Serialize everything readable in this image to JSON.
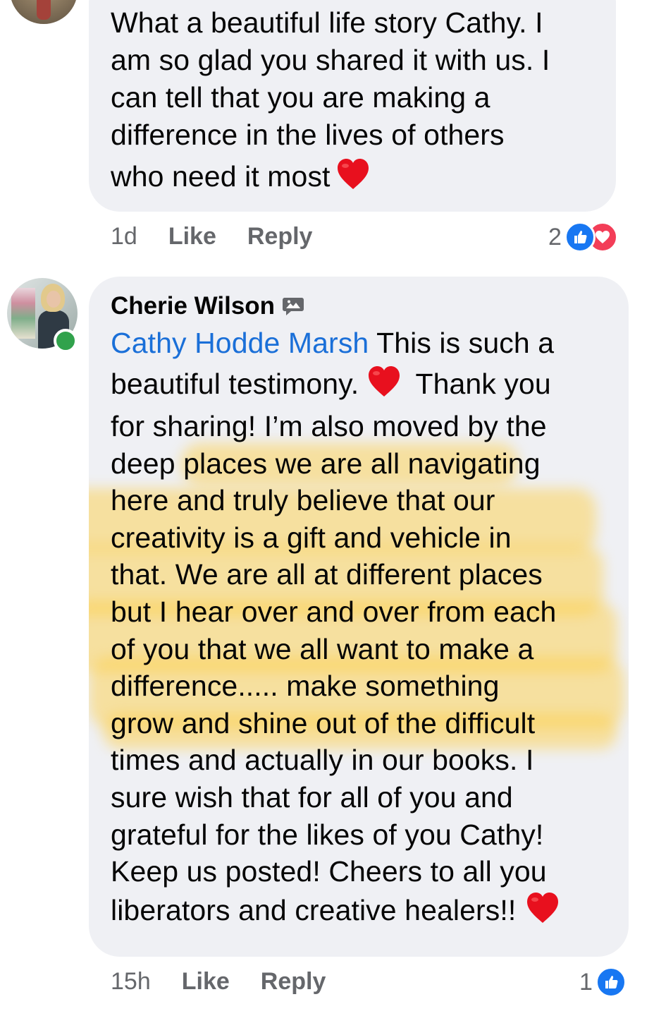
{
  "comment_1": {
    "text_lines": [
      "What a beautiful life story Cathy. I",
      "am so glad you shared it with us. I",
      "can tell that you are making a",
      "difference in the lives of others",
      "who need it most"
    ],
    "time": "1d",
    "like_label": "Like",
    "reply_label": "Reply",
    "reaction_count": "2",
    "reaction_icons": [
      "like-icon",
      "love-icon"
    ]
  },
  "comment_2": {
    "author": "Cherie Wilson",
    "author_badge_icon": "message-image-icon",
    "mention": "Cathy Hodde Marsh",
    "first_line_rest": " This is such a",
    "line_2a": "beautiful testimony. ",
    "line_2b": " Thank you",
    "text_lines": [
      "for sharing! I’m also moved by the",
      "deep places we are all navigating",
      "here and truly believe that our",
      "creativity is a gift and vehicle in",
      "that. We are all at different places",
      "but I hear over and over from each",
      "of you that we all want to make a",
      "difference..... make something",
      "grow and shine out of the difficult",
      "times and actually in our books. I",
      "sure wish that for all of you and",
      "grateful for the likes of you Cathy!",
      "Keep us posted! Cheers to all you"
    ],
    "last_line": "liberators and creative healers!!",
    "time": "15h",
    "like_label": "Like",
    "reply_label": "Reply",
    "reaction_count": "1",
    "reaction_icons": [
      "like-icon"
    ],
    "online": true
  },
  "colors": {
    "bubble": "#eff0f4",
    "mention": "#1a6fd8",
    "meta_text": "#65676b",
    "like": "#1877f2",
    "love": "#f33e58",
    "heart": "#e8101e",
    "online": "#31a24c",
    "highlighter": "#ffcd37"
  }
}
